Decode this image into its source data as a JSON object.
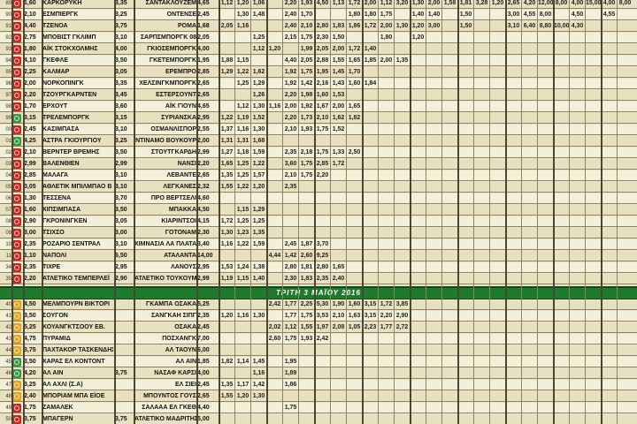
{
  "banner": "ΤΡΙΤΗ 3 ΜΑΪΟΥ 2016",
  "colors": {
    "red": "#c8251e",
    "green": "#2e9a3b",
    "yellow": "#e2a21e",
    "banner": "#1f7a2e"
  },
  "rows": [
    {
      "code": "89",
      "badge": "red",
      "odd1": "1,60",
      "home": "ΚΑΡΚΟΡΥΚΗ",
      "odd2": "3,35",
      "away": "ΣΑΝΤΑΚΛΟΥΖΕΜ",
      "oddA": "4,65",
      "extra": [
        "1,12",
        "1,20",
        "1,06",
        "",
        "2,20",
        "1,93",
        "4,50",
        "1,13",
        "1,72",
        "2,00",
        "1,12",
        "3,20",
        "1,30",
        "2,00",
        "1,58",
        "1,81",
        "3,28",
        "1,20",
        "2,65",
        "4,20",
        "12,00",
        "8,00",
        "4,00",
        "15,00",
        "4,00",
        "8,00"
      ]
    },
    {
      "code": "90",
      "badge": "red",
      "odd1": "2,10",
      "home": "ΕΣΜΠΙΕΡΓΚ",
      "odd2": "3,25",
      "away": "ΟΝΤΕΝΣΕ",
      "oddA": "2,45",
      "extra": [
        "",
        "1,30",
        "1,48",
        "",
        "2,40",
        "1,70",
        "",
        "",
        "1,80",
        "1,80",
        "1,75",
        "",
        "1,40",
        "1,40",
        "",
        "1,50",
        "",
        "",
        "3,00",
        "4,55",
        "8,00",
        "",
        "4,50",
        "",
        "4,55",
        ""
      ]
    },
    {
      "code": "91",
      "badge": "red",
      "odd1": "4,40",
      "home": "ΤΖΕΝΟΑ",
      "odd2": "3,75",
      "away": "ΡΟΜΑ",
      "oddA": "1,68",
      "extra": [
        "2,05",
        "1,16",
        "",
        "",
        "2,40",
        "2,10",
        "2,80",
        "1,83",
        "1,86",
        "1,72",
        "2,00",
        "1,30",
        "1,20",
        "3,00",
        "",
        "1,50",
        "",
        "",
        "3,10",
        "6,40",
        "8,80",
        "10,00",
        "4,30",
        "",
        "",
        ""
      ]
    },
    {
      "code": "92",
      "badge": "red",
      "odd1": "2,75",
      "home": "ΜΠΟΒΙΣΤ ΓΚΛΙΜΠ",
      "odd2": "3,10",
      "away": "ΣΑΡΠΣΜΠΟΡΓΚ 08",
      "oddA": "2,05",
      "extra": [
        "",
        "",
        "1,25",
        "",
        "2,15",
        "1,75",
        "2,30",
        "1,50",
        "",
        "",
        "1,80",
        "",
        "1,20",
        "",
        "",
        "",
        "",
        "",
        "",
        "",
        "",
        "",
        "",
        "",
        "",
        ""
      ]
    },
    {
      "code": "93",
      "badge": "red",
      "odd1": "1,80",
      "home": "ΑΪΚ ΣΤΟΚΧΟΛΜΗΣ",
      "odd2": "4,00",
      "away": "ΓΚΙΟΣΕΜΠΟΡΓΚ",
      "oddA": "4,00",
      "extra": [
        "",
        "",
        "1,12",
        "1,20",
        "",
        "1,99",
        "2,05",
        "2,00",
        "1,72",
        "1,40",
        "",
        "",
        "",
        "",
        "",
        "",
        "",
        "",
        "",
        "",
        "",
        "",
        "",
        "",
        "",
        ""
      ]
    },
    {
      "code": "94",
      "badge": "red",
      "odd1": "4,10",
      "home": "ΓΚΕΦΛΕ",
      "odd2": "3,50",
      "away": "ΓΚΕΤΕΜΠΟΡΓΚ",
      "oddA": "1,95",
      "extra": [
        "1,88",
        "1,15",
        "",
        "",
        "4,40",
        "2,05",
        "2,88",
        "1,55",
        "1,65",
        "1,85",
        "2,00",
        "1,35",
        "",
        "",
        "",
        "",
        "",
        "",
        "",
        "",
        "",
        "",
        "",
        "",
        "",
        ""
      ]
    },
    {
      "code": "95",
      "badge": "red",
      "odd1": "2,25",
      "home": "ΚΑΛΜΑΡ",
      "odd2": "3,05",
      "away": "ΕΡΕΜΠΡΟ",
      "oddA": "2,85",
      "extra": [
        "1,29",
        "1,22",
        "1,62",
        "",
        "1,92",
        "1,75",
        "1,95",
        "1,45",
        "1,70",
        "",
        "",
        "",
        "",
        "",
        "",
        "",
        "",
        "",
        "",
        "",
        "",
        "",
        "",
        "",
        "",
        ""
      ]
    },
    {
      "code": "96",
      "badge": "red",
      "odd1": "2,00",
      "home": "ΝΟΡΚΟΠΙΝΓΚ",
      "odd2": "3,35",
      "away": "ΧΕΛΣΙΝΓΚΜΠΟΡΓΚ",
      "oddA": "2,65",
      "extra": [
        "",
        "1,25",
        "1,29",
        "",
        "1,92",
        "1,42",
        "2,16",
        "1,43",
        "1,60",
        "1,84",
        "",
        "",
        "",
        "",
        "",
        "",
        "",
        "",
        "",
        "",
        "",
        "",
        "",
        "",
        "",
        ""
      ]
    },
    {
      "code": "97",
      "badge": "red",
      "odd1": "2,20",
      "home": "ΤΖΟΥΡΓΚΑΡΝΤΕΝ",
      "odd2": "3,45",
      "away": "ΕΣΤΕΡΣΟΥΝΤ",
      "oddA": "2,65",
      "extra": [
        "",
        "",
        "1,26",
        "",
        "2,20",
        "1,98",
        "1,60",
        "1,53",
        "",
        "",
        "",
        "",
        "",
        "",
        "",
        "",
        "",
        "",
        "",
        "",
        "",
        "",
        "",
        "",
        "",
        ""
      ]
    },
    {
      "code": "98",
      "badge": "red",
      "odd1": "1,70",
      "home": "ΕΡΧΟΥΤ",
      "odd2": "3,60",
      "away": "ΑΪΚ ΓΙΟΥΝ",
      "oddA": "4,65",
      "extra": [
        "",
        "1,12",
        "1,30",
        "1,16",
        "2,00",
        "1,92",
        "1,67",
        "2,00",
        "1,65",
        "",
        "",
        "",
        "",
        "",
        "",
        "",
        "",
        "",
        "",
        "",
        "",
        "",
        "",
        "",
        "",
        ""
      ]
    },
    {
      "code": "99",
      "badge": "green",
      "odd1": "3,15",
      "home": "ΤΡΕΛΕΜΠΟΡΓΚ",
      "odd2": "3,15",
      "away": "ΣΥΡΙΑΝΣΚΑ",
      "oddA": "2,95",
      "extra": [
        "1,22",
        "1,19",
        "1,52",
        "",
        "2,20",
        "1,73",
        "2,10",
        "1,62",
        "1,82",
        "",
        "",
        "",
        "",
        "",
        "",
        "",
        "",
        "",
        "",
        "",
        "",
        "",
        "",
        "",
        "",
        ""
      ]
    },
    {
      "code": "00",
      "badge": "red",
      "odd1": "2,45",
      "home": "ΚΑΣΙΜΠΑΣΑ",
      "odd2": "3,10",
      "away": "ΟΣΜΑΝΛΙΣΠΟΡ",
      "oddA": "2,55",
      "extra": [
        "1,37",
        "1,16",
        "1,30",
        "",
        "2,10",
        "1,93",
        "1,75",
        "1,52",
        "",
        "",
        "",
        "",
        "",
        "",
        "",
        "",
        "",
        "",
        "",
        "",
        "",
        "",
        "",
        "",
        "",
        ""
      ]
    },
    {
      "code": "01",
      "badge": "green",
      "odd1": "4,25",
      "home": "ΑΣΤΡΑ ΓΚΙΟΥΡΓΙΟΥ",
      "odd2": "3,25",
      "away": "ΝΤΙΝΑΜΟ ΒΟΥΚΟΥΡ",
      "oddA": "2,00",
      "extra": [
        "1,31",
        "1,31",
        "1,68",
        "",
        "",
        "",
        "",
        "",
        "",
        "",
        "",
        "",
        "",
        "",
        "",
        "",
        "",
        "",
        "",
        "",
        "",
        "",
        "",
        "",
        "",
        ""
      ]
    },
    {
      "code": "02",
      "badge": "red",
      "odd1": "2,10",
      "home": "ΒΕΡΝΤΕΡ ΒΡΕΜΗΣ",
      "odd2": "3,50",
      "away": "ΣΤΟΥΤΓΚΑΡΔΗ",
      "oddA": "2,99",
      "extra": [
        "1,27",
        "1,18",
        "1,59",
        "",
        "2,35",
        "2,18",
        "1,75",
        "1,33",
        "2,50",
        "",
        "",
        "",
        "",
        "",
        "",
        "",
        "",
        "",
        "",
        "",
        "",
        "",
        "",
        "",
        "",
        ""
      ]
    },
    {
      "code": "03",
      "badge": "red",
      "odd1": "2,99",
      "home": "ΒΑΛΕΝΘΙΕΝ",
      "odd2": "2,99",
      "away": "ΝΑΝΣΙ",
      "oddA": "2,20",
      "extra": [
        "1,65",
        "1,25",
        "1,22",
        "",
        "3,60",
        "1,75",
        "2,85",
        "1,72",
        "",
        "",
        "",
        "",
        "",
        "",
        "",
        "",
        "",
        "",
        "",
        "",
        "",
        "",
        "",
        "",
        "",
        ""
      ]
    },
    {
      "code": "04",
      "badge": "red",
      "odd1": "2,85",
      "home": "ΜΑΛΑΓΑ",
      "odd2": "3,10",
      "away": "ΛΕΒΑΝΤΕ",
      "oddA": "2,65",
      "extra": [
        "1,35",
        "1,25",
        "1,57",
        "",
        "2,10",
        "1,75",
        "2,20",
        "",
        "",
        "",
        "",
        "",
        "",
        "",
        "",
        "",
        "",
        "",
        "",
        "",
        "",
        "",
        "",
        "",
        "",
        ""
      ]
    },
    {
      "code": "05",
      "badge": "red",
      "odd1": "3,05",
      "home": "ΑΘΛΕΤΙΚ ΜΠΙΛΜΠΑΟ Β",
      "odd2": "3,10",
      "away": "ΛΕΓΚΑΝΕΣ",
      "oddA": "2,32",
      "extra": [
        "1,55",
        "1,22",
        "1,20",
        "",
        "2,35",
        "",
        "",
        "",
        "",
        "",
        "",
        "",
        "",
        "",
        "",
        "",
        "",
        "",
        "",
        "",
        "",
        "",
        "",
        "",
        "",
        ""
      ]
    },
    {
      "code": "06",
      "badge": "red",
      "odd1": "1,30",
      "home": "ΤΕΣΣΕΝΑ",
      "odd2": "3,70",
      "away": "ΠΡΟ ΒΕΡΤΣΕΛΙ",
      "oddA": "4,60",
      "extra": [
        "",
        "",
        "",
        "",
        "",
        "",
        "",
        "",
        "",
        "",
        "",
        "",
        "",
        "",
        "",
        "",
        "",
        "",
        "",
        "",
        "",
        "",
        "",
        "",
        "",
        ""
      ]
    },
    {
      "code": "07",
      "badge": "red",
      "odd1": "1,60",
      "home": "ΧΙΠΣΙΜΠΑΣΑ",
      "odd2": "3,50",
      "away": "ΜΠΑΚΚΑ",
      "oddA": "4,50",
      "extra": [
        "",
        "1,15",
        "1,29",
        "",
        "",
        "",
        "",
        "",
        "",
        "",
        "",
        "",
        "",
        "",
        "",
        "",
        "",
        "",
        "",
        "",
        "",
        "",
        "",
        "",
        "",
        ""
      ]
    },
    {
      "code": "08",
      "badge": "red",
      "odd1": "2,90",
      "home": "ΓΚΡΟΝΙΝΓΚΕΝ",
      "odd2": "3,05",
      "away": "ΚΙΑΡΙΝΤΣΟΙ",
      "oddA": "4,15",
      "extra": [
        "1,72",
        "1,25",
        "1,25",
        "",
        "",
        "",
        "",
        "",
        "",
        "",
        "",
        "",
        "",
        "",
        "",
        "",
        "",
        "",
        "",
        "",
        "",
        "",
        "",
        "",
        "",
        ""
      ]
    },
    {
      "code": "09",
      "badge": "red",
      "odd1": "3,00",
      "home": "ΤΣΙΧΣΟ",
      "odd2": "3,00",
      "away": "ΓΟΤΟΝΑΜ",
      "oddA": "2,30",
      "extra": [
        "1,30",
        "1,23",
        "1,35",
        "",
        "",
        "",
        "",
        "",
        "",
        "",
        "",
        "",
        "",
        "",
        "",
        "",
        "",
        "",
        "",
        "",
        "",
        "",
        "",
        "",
        "",
        ""
      ]
    },
    {
      "code": "10",
      "badge": "red",
      "odd1": "2,35",
      "home": "ΡΟΖΑΡΙΟ ΣΕΝΤΡΑΛ",
      "odd2": "3,10",
      "away": "ΧΙΜΝΑΣΙΑ ΛΑ ΠΛΑΤΑ",
      "oddA": "3,40",
      "extra": [
        "1,16",
        "1,22",
        "1,59",
        "",
        "2,45",
        "1,87",
        "3,70",
        "",
        "",
        "",
        "",
        "",
        "",
        "",
        "",
        "",
        "",
        "",
        "",
        "",
        "",
        "",
        "",
        "",
        "",
        ""
      ]
    },
    {
      "code": "11",
      "badge": "red",
      "odd1": "1,10",
      "home": "ΝΑΠΟΛΙ",
      "odd2": "6,50",
      "away": "ΑΤΑΛΑΝΤΑ",
      "oddA": "14,00",
      "extra": [
        "",
        "",
        "",
        "4,44",
        "1,42",
        "2,60",
        "9,25",
        "",
        "",
        "",
        "",
        "",
        "",
        "",
        "",
        "",
        "",
        "",
        "",
        "",
        "",
        "",
        "",
        "",
        "",
        ""
      ]
    },
    {
      "code": "34",
      "badge": "red",
      "odd1": "2,35",
      "home": "ΤΙΧΡΕ",
      "odd2": "2,95",
      "away": "ΛΑΝΟΥΣ",
      "oddA": "2,95",
      "extra": [
        "1,53",
        "1,24",
        "1,38",
        "",
        "2,80",
        "1,81",
        "2,80",
        "1,65",
        "",
        "",
        "",
        "",
        "",
        "",
        "",
        "",
        "",
        "",
        "",
        "",
        "",
        "",
        "",
        "",
        "",
        ""
      ]
    },
    {
      "code": "35",
      "badge": "red",
      "odd1": "2,20",
      "home": "ΑΤΛΕΤΙΚΟ ΤΕΜΠΕΡΛΕΪ",
      "odd2": "2,90",
      "away": "ΑΤΛΕΤΙΚΟ ΤΟΥΚΟΥΜΑΝ",
      "oddA": "2,99",
      "extra": [
        "1,19",
        "1,15",
        "1,40",
        "",
        "2,30",
        "1,83",
        "2,35",
        "2,40",
        "",
        "",
        "",
        "",
        "",
        "",
        "",
        "",
        "",
        "",
        "",
        "",
        "",
        "",
        "",
        "",
        "",
        ""
      ]
    }
  ],
  "rows2": [
    {
      "code": "40",
      "badge": "yellow",
      "odd1": "4,50",
      "home": "ΜΕΛΜΠΟΥΡΝ ΒΙΚΤΟΡΙ",
      "odd2": "",
      "away": "ΓΚΑΜΠΑ ΟΣΑΚΑ",
      "oddA": "5,25",
      "extra": [
        "",
        "",
        "",
        "2,42",
        "1,77",
        "2,25",
        "5,30",
        "1,90",
        "1,60",
        "3,15",
        "1,72",
        "3,85",
        "",
        "",
        "",
        "",
        "",
        "",
        "",
        "",
        "",
        "",
        "",
        "",
        "",
        ""
      ]
    },
    {
      "code": "41",
      "badge": "yellow",
      "odd1": "3,50",
      "home": "ΣΟΥΓΟΝ",
      "odd2": "",
      "away": "ΣΑΝΓΚΑΗ ΣΙΠΓ",
      "oddA": "2,35",
      "extra": [
        "1,20",
        "1,16",
        "1,30",
        "",
        "1,77",
        "1,75",
        "3,53",
        "2,10",
        "1,63",
        "3,15",
        "2,20",
        "2,90",
        "",
        "",
        "",
        "",
        "",
        "",
        "",
        "",
        "",
        "",
        "",
        "",
        "",
        ""
      ]
    },
    {
      "code": "42",
      "badge": "yellow",
      "odd1": "5,25",
      "home": "ΚΟΥΑΝΓΚΤΣΟΟΥ ΕΒ.",
      "odd2": "",
      "away": "ΟΣΑΚΑ",
      "oddA": "2,45",
      "extra": [
        "",
        "",
        "",
        "2,02",
        "1,12",
        "1,55",
        "1,97",
        "2,08",
        "1,05",
        "2,23",
        "1,77",
        "2,72",
        "",
        "",
        "",
        "",
        "",
        "",
        "",
        "",
        "",
        "",
        "",
        "",
        "",
        ""
      ]
    },
    {
      "code": "43",
      "badge": "yellow",
      "odd1": "4,75",
      "home": "ΠΥΡΑΜΙΔ",
      "odd2": "",
      "away": "ΠΟΣΧΑΝΓΚ",
      "oddA": "7,00",
      "extra": [
        "",
        "",
        "",
        "2,60",
        "1,75",
        "1,93",
        "2,42",
        "",
        "",
        "",
        "",
        "",
        "",
        "",
        "",
        "",
        "",
        "",
        "",
        "",
        "",
        "",
        "",
        "",
        "",
        ""
      ]
    },
    {
      "code": "44",
      "badge": "yellow",
      "odd1": "3,75",
      "home": "ΠΑΧΤΑΚΟΡ ΤΑΣΚΕΝΔΗΣ",
      "odd2": "",
      "away": "ΑΛ ΤΑΟΥΝ",
      "oddA": "6,00",
      "extra": [
        "",
        "",
        "",
        "",
        "",
        "",
        "",
        "",
        "",
        "",
        "",
        "",
        "",
        "",
        "",
        "",
        "",
        "",
        "",
        "",
        "",
        "",
        "",
        "",
        "",
        ""
      ]
    },
    {
      "code": "45",
      "badge": "green",
      "odd1": "3,50",
      "home": "ΧΑΡΑΣ ΕΛ ΚΟΝΤΟΝΤ",
      "odd2": "",
      "away": "ΑΛ ΑΙΝ",
      "oddA": "1,85",
      "extra": [
        "1,82",
        "1,14",
        "1,45",
        "",
        "1,95",
        "",
        "",
        "",
        "",
        "",
        "",
        "",
        "",
        "",
        "",
        "",
        "",
        "",
        "",
        "",
        "",
        "",
        "",
        "",
        "",
        ""
      ]
    },
    {
      "code": "46",
      "badge": "green",
      "odd1": "4,20",
      "home": "ΑΛ ΑΙΝ",
      "odd2": "3,75",
      "away": "ΝΑΣΑΦ ΚΑΡΣΙ",
      "oddA": "4,00",
      "extra": [
        "",
        "",
        "1,16",
        "",
        "1,89",
        "",
        "",
        "",
        "",
        "",
        "",
        "",
        "",
        "",
        "",
        "",
        "",
        "",
        "",
        "",
        "",
        "",
        "",
        "",
        "",
        ""
      ]
    },
    {
      "code": "47",
      "badge": "yellow",
      "odd1": "3,25",
      "home": "ΑΛ ΑΧΛΙ (Σ.Α)",
      "odd2": "",
      "away": "ΕΛ ΣΙΕΙ",
      "oddA": "2,45",
      "extra": [
        "1,35",
        "1,17",
        "1,42",
        "",
        "1,86",
        "",
        "",
        "",
        "",
        "",
        "",
        "",
        "",
        "",
        "",
        "",
        "",
        "",
        "",
        "",
        "",
        "",
        "",
        "",
        "",
        ""
      ]
    },
    {
      "code": "48",
      "badge": "yellow",
      "odd1": "2,40",
      "home": "ΜΠΟΡΙΑΜ ΜΠΑ ΕΪΟΕ",
      "odd2": "",
      "away": "ΜΠΟΥΝΤΟΣ ΓΟΥΣ",
      "oddA": "2,65",
      "extra": [
        "1,55",
        "1,20",
        "1,30",
        "",
        "",
        "",
        "",
        "",
        "",
        "",
        "",
        "",
        "",
        "",
        "",
        "",
        "",
        "",
        "",
        "",
        "",
        "",
        "",
        "",
        "",
        ""
      ]
    },
    {
      "code": "49",
      "badge": "red",
      "odd1": "1,75",
      "home": "ΖΑΜΑΛΕΚ",
      "odd2": "",
      "away": "ΣΑΛΑΑΑ ΕΛ ΓΚΕΘ",
      "oddA": "4,40",
      "extra": [
        "",
        "",
        "",
        "",
        "1,75",
        "",
        "",
        "",
        "",
        "",
        "",
        "",
        "",
        "",
        "",
        "",
        "",
        "",
        "",
        "",
        "",
        "",
        "",
        "",
        "",
        ""
      ]
    },
    {
      "code": "50",
      "badge": "red",
      "odd1": "3,75",
      "home": "ΜΠΑΓΕΡΝ",
      "odd2": "3,75",
      "away": "ΑΤΛΕΤΙΚΟ ΜΑΔΡΙΤΗΣ",
      "oddA": "5,00",
      "extra": [
        "",
        "",
        "",
        "",
        "",
        "",
        "",
        "",
        "",
        "",
        "",
        "",
        "",
        "",
        "",
        "",
        "",
        "",
        "",
        "",
        "",
        "",
        "",
        "",
        "",
        ""
      ]
    }
  ]
}
